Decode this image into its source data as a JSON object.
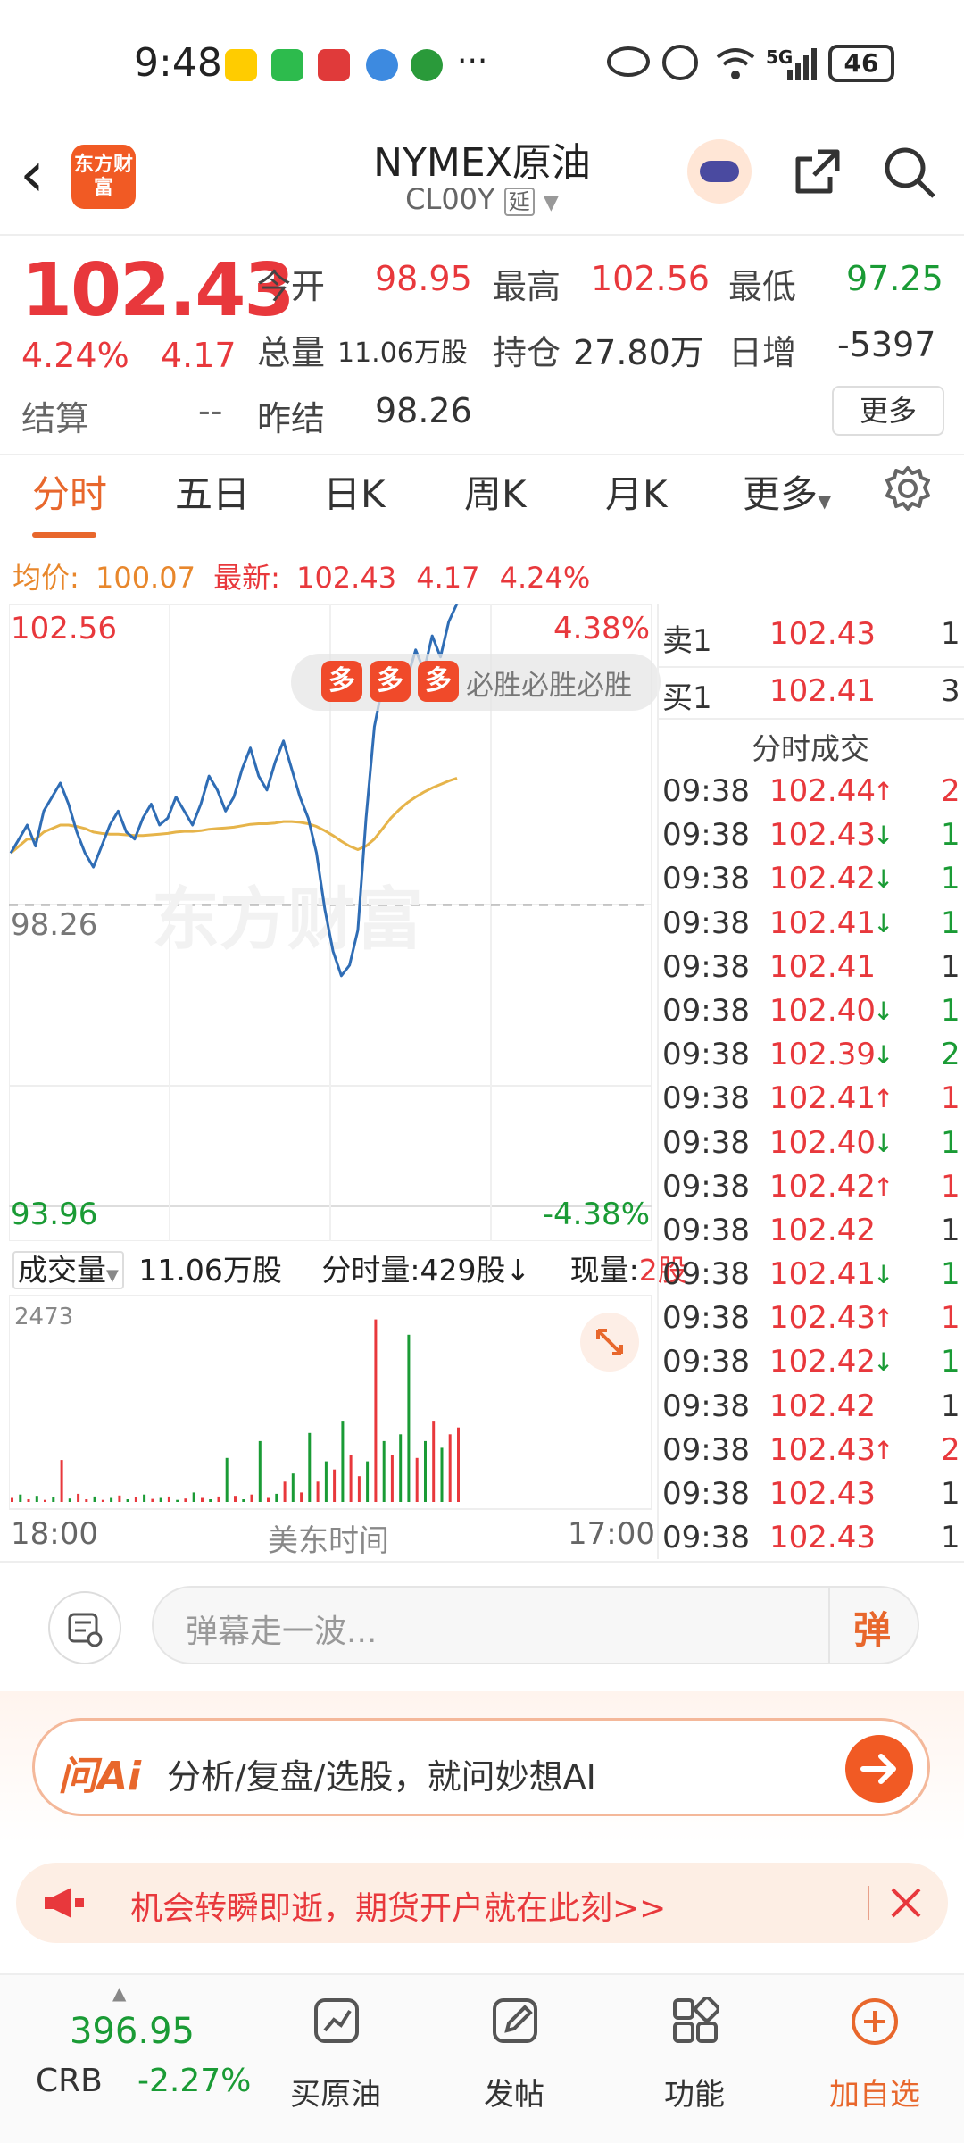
{
  "status": {
    "time": "9:48",
    "more": "···",
    "network": "5G",
    "battery": "46"
  },
  "header": {
    "title": "NYMEX原油",
    "code": "CL00Y",
    "code_tag": "延",
    "logo_text": "东方财富"
  },
  "quote": {
    "price": "102.43",
    "change_pct": "4.24%",
    "change": "4.17",
    "open_label": "今开",
    "open": "98.95",
    "high_label": "最高",
    "high": "102.56",
    "low_label": "最低",
    "low": "97.25",
    "volume_label": "总量",
    "volume": "11.06万股",
    "oi_label": "持仓",
    "oi": "27.80万",
    "daily_inc_label": "日增",
    "daily_inc": "-5397",
    "settle_label": "结算",
    "settle": "--",
    "prev_settle_label": "昨结",
    "prev_settle": "98.26",
    "more_button": "更多"
  },
  "tabs": [
    "分时",
    "五日",
    "日K",
    "周K",
    "月K",
    "更多"
  ],
  "infoline": {
    "avg_label": "均价:",
    "avg": "100.07",
    "latest_label": "最新:",
    "latest": "102.43",
    "chg": "4.17",
    "pct": "4.24%"
  },
  "chart_data": {
    "type": "line",
    "y_top": "102.56",
    "y_mid": "98.26",
    "y_bottom": "93.96",
    "pct_top": "4.38%",
    "pct_bottom": "-4.38%",
    "ylim": [
      93.96,
      102.56
    ],
    "x_start": "18:00",
    "x_mid": "美东时间",
    "x_end": "17:00",
    "price_series": [
      99.0,
      99.2,
      99.4,
      99.1,
      99.6,
      99.8,
      100.0,
      99.7,
      99.3,
      99.0,
      98.8,
      99.1,
      99.4,
      99.6,
      99.3,
      99.2,
      99.5,
      99.7,
      99.4,
      99.5,
      99.8,
      99.6,
      99.4,
      99.7,
      100.1,
      99.9,
      99.6,
      99.8,
      100.2,
      100.5,
      100.1,
      99.9,
      100.3,
      100.6,
      100.2,
      99.8,
      99.5,
      99.0,
      98.2,
      97.6,
      97.25,
      97.4,
      97.9,
      99.5,
      100.8,
      101.4,
      101.2,
      101.7,
      101.5,
      101.9,
      101.6,
      102.1,
      101.8,
      102.3,
      102.56
    ],
    "avg_series": [
      99.0,
      99.1,
      99.2,
      99.2,
      99.3,
      99.35,
      99.4,
      99.4,
      99.38,
      99.35,
      99.3,
      99.28,
      99.27,
      99.27,
      99.26,
      99.25,
      99.25,
      99.26,
      99.27,
      99.28,
      99.3,
      99.31,
      99.31,
      99.32,
      99.34,
      99.35,
      99.36,
      99.37,
      99.39,
      99.41,
      99.42,
      99.42,
      99.43,
      99.45,
      99.45,
      99.44,
      99.42,
      99.38,
      99.32,
      99.25,
      99.17,
      99.1,
      99.05,
      99.1,
      99.2,
      99.35,
      99.5,
      99.62,
      99.72,
      99.8,
      99.87,
      99.93,
      99.98,
      100.03,
      100.07
    ],
    "volume_label": "成交量",
    "volume_total": "11.06万股",
    "tick_vol_label": "分时量:429股",
    "current_vol_label": "现量:",
    "current_vol": "2股",
    "volume_max": "2473",
    "volume_series": [
      60,
      110,
      40,
      90,
      30,
      70,
      620,
      50,
      120,
      40,
      80,
      30,
      60,
      95,
      40,
      70,
      110,
      45,
      60,
      80,
      30,
      50,
      140,
      60,
      40,
      80,
      650,
      90,
      40,
      110,
      900,
      60,
      120,
      300,
      420,
      140,
      1020,
      300,
      600,
      480,
      1200,
      700,
      380,
      600,
      2700,
      900,
      700,
      1000,
      2473,
      650,
      900,
      1200,
      800,
      1000,
      1100
    ],
    "volume_colors": [
      "r",
      "g",
      "r",
      "g",
      "r",
      "g",
      "r",
      "g",
      "r",
      "r",
      "g",
      "r",
      "g",
      "r",
      "g",
      "r",
      "g",
      "r",
      "g",
      "r",
      "g",
      "r",
      "g",
      "r",
      "g",
      "r",
      "g",
      "r",
      "g",
      "r",
      "g",
      "r",
      "g",
      "r",
      "g",
      "r",
      "g",
      "r",
      "g",
      "r",
      "g",
      "r",
      "r",
      "g",
      "r",
      "g",
      "r",
      "g",
      "g",
      "r",
      "g",
      "r",
      "g",
      "r",
      "r"
    ]
  },
  "orderbook": {
    "sell_label": "卖1",
    "sell_price": "102.43",
    "sell_qty": "1",
    "buy_label": "买1",
    "buy_price": "102.41",
    "buy_qty": "3",
    "trades_title": "分时成交",
    "trades": [
      {
        "t": "09:38",
        "p": "102.44",
        "d": "↑",
        "q": "2"
      },
      {
        "t": "09:38",
        "p": "102.43",
        "d": "↓",
        "q": "1"
      },
      {
        "t": "09:38",
        "p": "102.42",
        "d": "↓",
        "q": "1"
      },
      {
        "t": "09:38",
        "p": "102.41",
        "d": "↓",
        "q": "1"
      },
      {
        "t": "09:38",
        "p": "102.41",
        "d": "",
        "q": "1"
      },
      {
        "t": "09:38",
        "p": "102.40",
        "d": "↓",
        "q": "1"
      },
      {
        "t": "09:38",
        "p": "102.39",
        "d": "↓",
        "q": "2"
      },
      {
        "t": "09:38",
        "p": "102.41",
        "d": "↑",
        "q": "1"
      },
      {
        "t": "09:38",
        "p": "102.40",
        "d": "↓",
        "q": "1"
      },
      {
        "t": "09:38",
        "p": "102.42",
        "d": "↑",
        "q": "1"
      },
      {
        "t": "09:38",
        "p": "102.42",
        "d": "",
        "q": "1"
      },
      {
        "t": "09:38",
        "p": "102.41",
        "d": "↓",
        "q": "1"
      },
      {
        "t": "09:38",
        "p": "102.43",
        "d": "↑",
        "q": "1"
      },
      {
        "t": "09:38",
        "p": "102.42",
        "d": "↓",
        "q": "1"
      },
      {
        "t": "09:38",
        "p": "102.42",
        "d": "",
        "q": "1"
      },
      {
        "t": "09:38",
        "p": "102.43",
        "d": "↑",
        "q": "2"
      },
      {
        "t": "09:38",
        "p": "102.43",
        "d": "",
        "q": "1"
      },
      {
        "t": "09:38",
        "p": "102.43",
        "d": "",
        "q": "1"
      }
    ]
  },
  "overlay": {
    "badges": [
      "多",
      "多",
      "多"
    ],
    "banner": "必胜必胜必胜",
    "watermark": "东方财富"
  },
  "danmu": {
    "placeholder": "弹幕走一波...",
    "send": "弹"
  },
  "ai": {
    "brand": "问Ai",
    "text": "分析/复盘/选股，就问妙想AI"
  },
  "ad": {
    "text": "机会转瞬即逝，期货开户就在此刻>>"
  },
  "nav": {
    "index_value": "396.95",
    "index_name": "CRB",
    "index_change": "-2.27%",
    "items": [
      "买原油",
      "发帖",
      "功能",
      "加自选"
    ]
  },
  "colors": {
    "up": "#e8383c",
    "down": "#1a9b35",
    "accent": "#e8672c",
    "price_line": "#2f6db5",
    "avg_line": "#e6b44a"
  }
}
